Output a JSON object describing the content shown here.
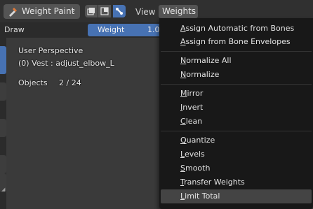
{
  "header": {
    "mode_label": "Weight Paint",
    "mode_icon": "weight-paint-mode-icon",
    "menus": {
      "view": "View",
      "weights": "Weights"
    },
    "tool_icons": [
      "vertex-select-icon",
      "face-select-icon",
      "bone-select-icon"
    ]
  },
  "toolbar": {
    "brush_name": "Draw",
    "weight_label": "Weight",
    "weight_value": "1.0"
  },
  "viewport": {
    "perspective": "User Perspective",
    "object_info": "(0) Vest : adjust_elbow_L",
    "objects_label": "Objects",
    "objects_value": "2 / 24"
  },
  "weights_menu": {
    "items": [
      "Assign Automatic from Bones",
      "Assign from Bone Envelopes",
      "Normalize All",
      "Normalize",
      "Mirror",
      "Invert",
      "Clean",
      "Quantize",
      "Levels",
      "Smooth",
      "Transfer Weights",
      "Limit Total"
    ],
    "hovered_item": "Limit Total"
  },
  "colors": {
    "accent": "#4772b3",
    "menu_bg": "#181818",
    "header_bg": "#303030",
    "viewport_bg": "#3a3a3a"
  }
}
